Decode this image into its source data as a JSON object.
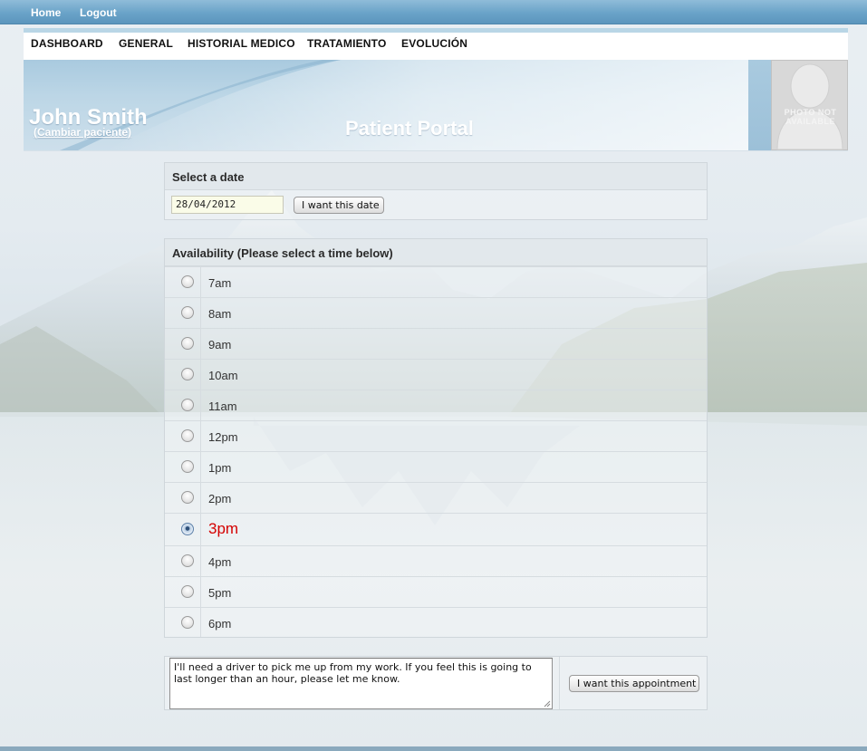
{
  "topnav": {
    "home": "Home",
    "logout": "Logout"
  },
  "mainnav": {
    "items": [
      "DASHBOARD",
      "GENERAL",
      "HISTORIAL MEDICO",
      "TRATAMIENTO",
      "EVOLUCIÓN"
    ]
  },
  "header": {
    "patient_name": "John Smith",
    "change_patient": "(Cambiar paciente)",
    "title": "Patient Portal",
    "photo_text": "PHOTO NOT AVAILABLE"
  },
  "date_section": {
    "heading": "Select a date",
    "date_value": "28/04/2012",
    "button": "I want this date"
  },
  "availability": {
    "heading": "Availability (Please select a time below)",
    "selected": "3pm",
    "slots": [
      "7am",
      "8am",
      "9am",
      "10am",
      "11am",
      "12pm",
      "1pm",
      "2pm",
      "3pm",
      "4pm",
      "5pm",
      "6pm"
    ]
  },
  "appointment": {
    "note": "I'll need a driver to pick me up from my work.  If you feel this is going to last longer than an hour, please let me know.",
    "button": "I want this appointment"
  },
  "colors": {
    "topbar": "#6aa3c8",
    "selected_time": "#d40000",
    "date_input_bg": "#fafce8"
  }
}
